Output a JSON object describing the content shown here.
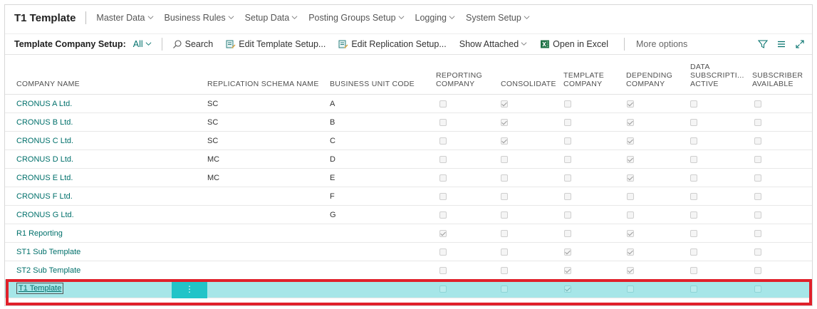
{
  "nav": {
    "app_title": "T1 Template",
    "items": [
      "Master Data",
      "Business Rules",
      "Setup Data",
      "Posting Groups Setup",
      "Logging",
      "System Setup"
    ]
  },
  "actionbar": {
    "title": "Template Company Setup:",
    "filter": "All",
    "search": "Search",
    "edit_template": "Edit Template Setup...",
    "edit_replication": "Edit Replication Setup...",
    "show_attached": "Show Attached",
    "open_excel": "Open in Excel",
    "more_options": "More options"
  },
  "columns": {
    "company_name": "COMPANY NAME",
    "schema": "REPLICATION SCHEMA NAME",
    "bu_code": "BUSINESS UNIT CODE",
    "reporting_1": "REPORTING",
    "reporting_2": "COMPANY",
    "consolidate": "CONSOLIDATE",
    "template_1": "TEMPLATE",
    "template_2": "COMPANY",
    "depending_1": "DEPENDING",
    "depending_2": "COMPANY",
    "datasub_1": "DATA",
    "datasub_2": "SUBSCRIPTI...",
    "datasub_3": "ACTIVE",
    "subscriber_1": "SUBSCRIBER",
    "subscriber_2": "AVAILABLE"
  },
  "rows": [
    {
      "name": "CRONUS A Ltd.",
      "schema": "SC",
      "bu": "A",
      "reporting": false,
      "consolidate": true,
      "template": false,
      "depending": true,
      "datasub": false,
      "subscriber": false
    },
    {
      "name": "CRONUS B Ltd.",
      "schema": "SC",
      "bu": "B",
      "reporting": false,
      "consolidate": true,
      "template": false,
      "depending": true,
      "datasub": false,
      "subscriber": false
    },
    {
      "name": "CRONUS C Ltd.",
      "schema": "SC",
      "bu": "C",
      "reporting": false,
      "consolidate": true,
      "template": false,
      "depending": true,
      "datasub": false,
      "subscriber": false
    },
    {
      "name": "CRONUS D Ltd.",
      "schema": "MC",
      "bu": "D",
      "reporting": false,
      "consolidate": false,
      "template": false,
      "depending": true,
      "datasub": false,
      "subscriber": false
    },
    {
      "name": "CRONUS E Ltd.",
      "schema": "MC",
      "bu": "E",
      "reporting": false,
      "consolidate": false,
      "template": false,
      "depending": true,
      "datasub": false,
      "subscriber": false
    },
    {
      "name": "CRONUS F Ltd.",
      "schema": "",
      "bu": "F",
      "reporting": false,
      "consolidate": false,
      "template": false,
      "depending": false,
      "datasub": false,
      "subscriber": false
    },
    {
      "name": "CRONUS G Ltd.",
      "schema": "",
      "bu": "G",
      "reporting": false,
      "consolidate": false,
      "template": false,
      "depending": false,
      "datasub": false,
      "subscriber": false
    },
    {
      "name": "R1 Reporting",
      "schema": "",
      "bu": "",
      "reporting": true,
      "consolidate": false,
      "template": false,
      "depending": true,
      "datasub": false,
      "subscriber": false
    },
    {
      "name": "ST1 Sub Template",
      "schema": "",
      "bu": "",
      "reporting": false,
      "consolidate": false,
      "template": true,
      "depending": true,
      "datasub": false,
      "subscriber": false
    },
    {
      "name": "ST2 Sub Template",
      "schema": "",
      "bu": "",
      "reporting": false,
      "consolidate": false,
      "template": true,
      "depending": true,
      "datasub": false,
      "subscriber": false
    },
    {
      "name": "T1 Template",
      "schema": "",
      "bu": "",
      "reporting": false,
      "consolidate": false,
      "template": true,
      "depending": false,
      "datasub": false,
      "subscriber": false,
      "selected": true
    }
  ],
  "row_menu": "⋮",
  "colors": {
    "accent": "#00706b",
    "selection": "#a6e6e8",
    "row_menu": "#21c4c8",
    "highlight_border": "#e0202a"
  },
  "icons": {
    "search": "search-icon",
    "edit_template": "edit-setup-icon",
    "edit_replication": "edit-replication-icon",
    "excel": "excel-icon",
    "filter": "filter-icon",
    "list": "list-view-icon",
    "expand": "expand-icon"
  }
}
